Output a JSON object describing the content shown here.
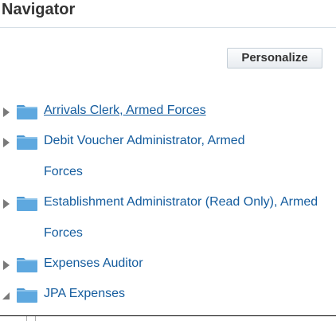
{
  "panel": {
    "title": "Navigator",
    "personalize_label": "Personalize"
  },
  "tree": {
    "nodes": [
      {
        "label": "Arrivals Clerk, Armed Forces",
        "expanded": false,
        "linked": true
      },
      {
        "label": "Debit Voucher Administrator, Armed Forces",
        "expanded": false,
        "linked": false
      },
      {
        "label": "Establishment Administrator (Read Only), Armed Forces",
        "expanded": false,
        "linked": false
      },
      {
        "label": "Expenses Auditor",
        "expanded": false,
        "linked": false
      },
      {
        "label": "JPA Expenses",
        "expanded": true,
        "linked": false
      }
    ]
  },
  "colors": {
    "title": "#333333",
    "link": "#145c9e",
    "folder": "#5ea8df",
    "twisty": "#7a7a7a"
  },
  "icons": {
    "collapsed": "triangle-right-icon",
    "expanded": "triangle-down-icon",
    "folder": "folder-icon"
  }
}
